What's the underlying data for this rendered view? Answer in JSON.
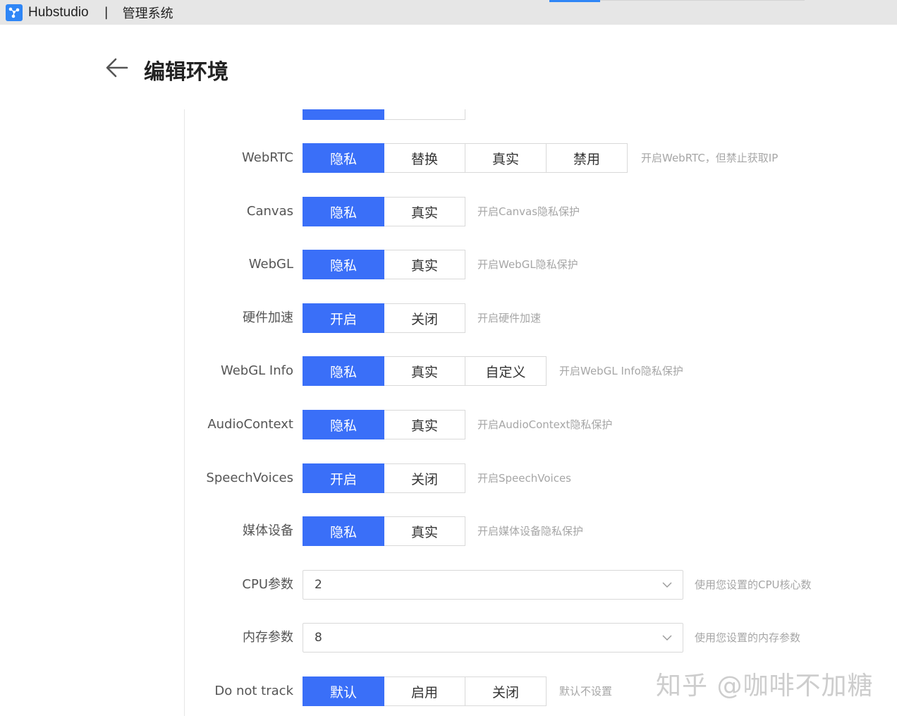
{
  "window": {
    "app_name": "Hubstudio",
    "separator": "|",
    "subtitle": "管理系统",
    "accent": "#2f86f6"
  },
  "header": {
    "title": "编辑环境",
    "back_icon": "arrow-left-icon"
  },
  "rows": {
    "webrtc": {
      "label": "WebRTC",
      "options": [
        "隐私",
        "替换",
        "真实",
        "禁用"
      ],
      "selected": "隐私",
      "hint": "开启WebRTC，但禁止获取IP"
    },
    "canvas": {
      "label": "Canvas",
      "options": [
        "隐私",
        "真实"
      ],
      "selected": "隐私",
      "hint": "开启Canvas隐私保护"
    },
    "webgl": {
      "label": "WebGL",
      "options": [
        "隐私",
        "真实"
      ],
      "selected": "隐私",
      "hint": "开启WebGL隐私保护"
    },
    "hardware": {
      "label": "硬件加速",
      "options": [
        "开启",
        "关闭"
      ],
      "selected": "开启",
      "hint": "开启硬件加速"
    },
    "webglinfo": {
      "label": "WebGL Info",
      "options": [
        "隐私",
        "真实",
        "自定义"
      ],
      "selected": "隐私",
      "hint": "开启WebGL Info隐私保护"
    },
    "audio": {
      "label": "AudioContext",
      "options": [
        "隐私",
        "真实"
      ],
      "selected": "隐私",
      "hint": "开启AudioContext隐私保护"
    },
    "speech": {
      "label": "SpeechVoices",
      "options": [
        "开启",
        "关闭"
      ],
      "selected": "开启",
      "hint": "开启SpeechVoices"
    },
    "media": {
      "label": "媒体设备",
      "options": [
        "隐私",
        "真实"
      ],
      "selected": "隐私",
      "hint": "开启媒体设备隐私保护"
    },
    "cpu": {
      "label": "CPU参数",
      "value": "2",
      "hint": "使用您设置的CPU核心数"
    },
    "memory": {
      "label": "内存参数",
      "value": "8",
      "hint": "使用您设置的内存参数"
    },
    "dnt": {
      "label": "Do not track",
      "options": [
        "默认",
        "启用",
        "关闭"
      ],
      "selected": "默认",
      "hint": "默认不设置"
    }
  },
  "colors": {
    "active": "#3a6ff8",
    "hint": "#a6a6a6"
  },
  "watermark": "知乎 @咖啡不加糖"
}
